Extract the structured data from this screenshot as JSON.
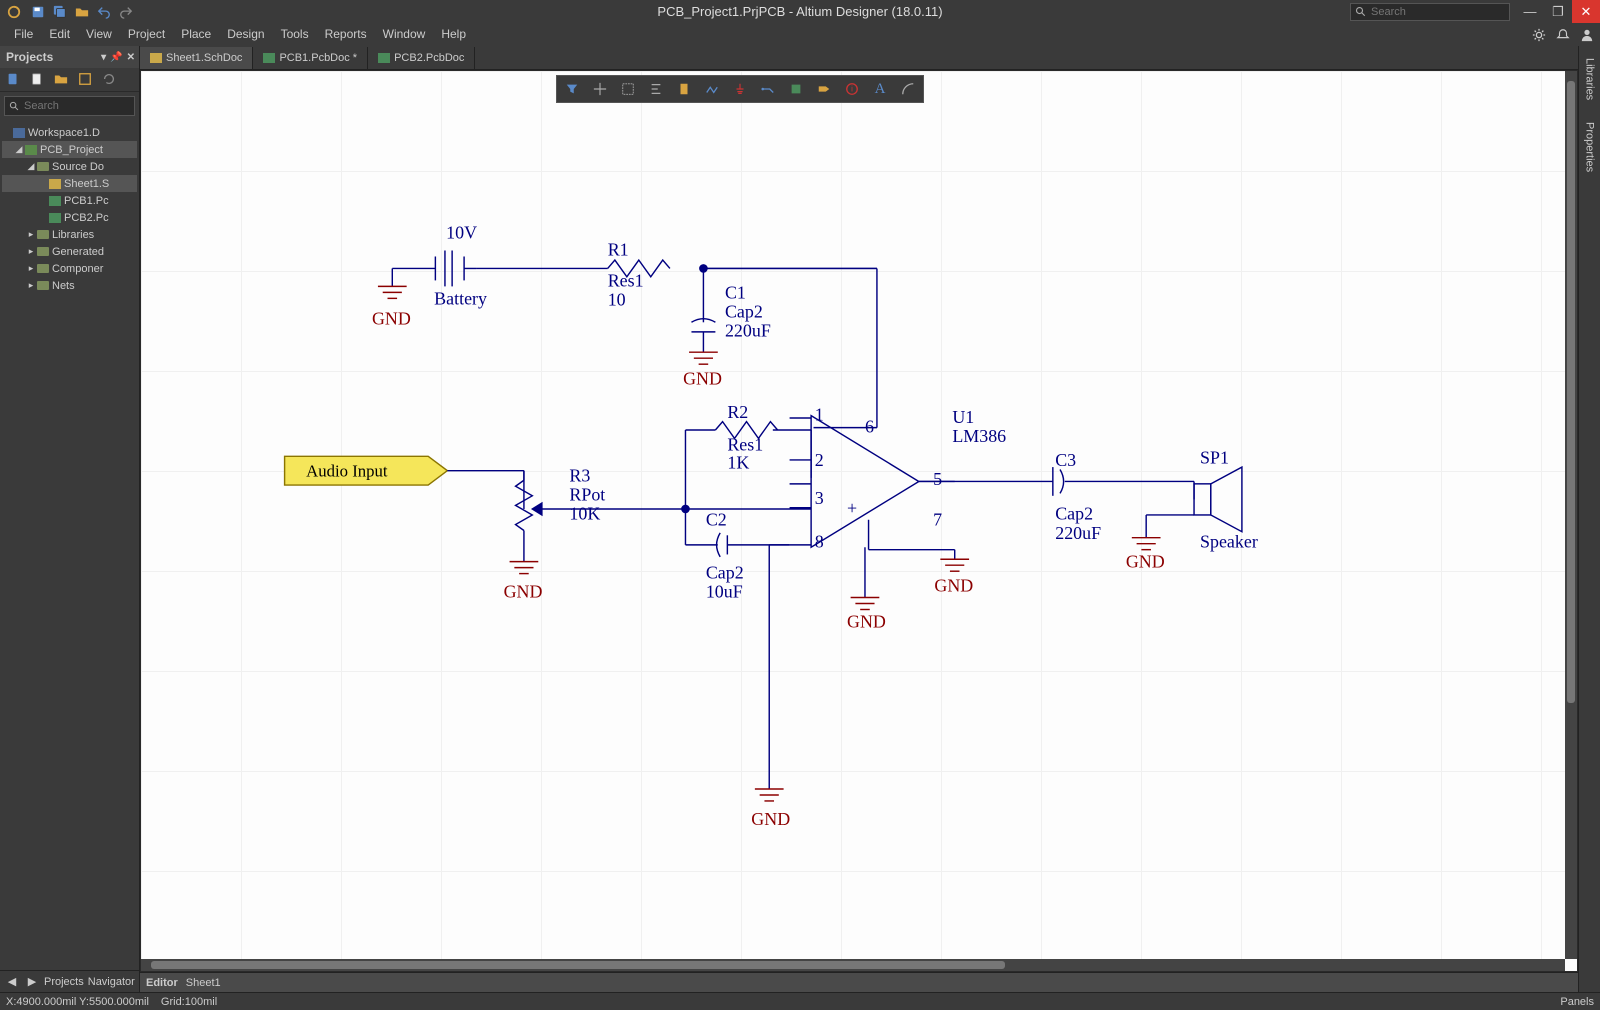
{
  "title": "PCB_Project1.PrjPCB - Altium Designer (18.0.11)",
  "search_placeholder": "Search",
  "menu": [
    "File",
    "Edit",
    "View",
    "Project",
    "Place",
    "Design",
    "Tools",
    "Reports",
    "Window",
    "Help"
  ],
  "projects": {
    "header": "Projects",
    "search_placeholder": "Search",
    "tree": {
      "workspace": "Workspace1.D",
      "project": "PCB_Project",
      "source": "Source Do",
      "files": [
        "Sheet1.S",
        "PCB1.Pc",
        "PCB2.Pc"
      ],
      "folders": [
        "Libraries",
        "Generated",
        "Componer",
        "Nets"
      ]
    },
    "footer_tabs": [
      "Projects",
      "Navigator"
    ]
  },
  "tabs": [
    {
      "label": "Sheet1.SchDoc",
      "type": "sch",
      "active": true
    },
    {
      "label": "PCB1.PcbDoc *",
      "type": "pcb",
      "active": false
    },
    {
      "label": "PCB2.PcbDoc",
      "type": "pcb",
      "active": false
    }
  ],
  "right_tabs": [
    "Libraries",
    "Properties"
  ],
  "editor_info": {
    "label": "Editor",
    "doc": "Sheet1"
  },
  "status": {
    "coords": "X:4900.000mil Y:5500.000mil",
    "grid": "Grid:100mil",
    "panels": "Panels"
  },
  "schematic": {
    "labels": {
      "v10": "10V",
      "battery": "Battery",
      "r1": "R1",
      "r1t": "Res1",
      "r1v": "10",
      "c1": "C1",
      "c1t": "Cap2",
      "c1v": "220uF",
      "r2": "R2",
      "r2t": "Res1",
      "r2v": "1K",
      "r3": "R3",
      "r3t": "RPot",
      "r3v": "10K",
      "c2": "C2",
      "c2t": "Cap2",
      "c2v": "10uF",
      "u1": "U1",
      "u1t": "LM386",
      "c3": "C3",
      "c3t": "Cap2",
      "c3v": "220uF",
      "sp1": "SP1",
      "sp1t": "Speaker",
      "audio_in": "Audio Input",
      "gnd": "GND",
      "pins": {
        "p1": "1",
        "p2": "2",
        "p3": "3",
        "p5": "5",
        "p6": "6",
        "p7": "7",
        "p8": "8"
      },
      "plus": "+"
    }
  }
}
